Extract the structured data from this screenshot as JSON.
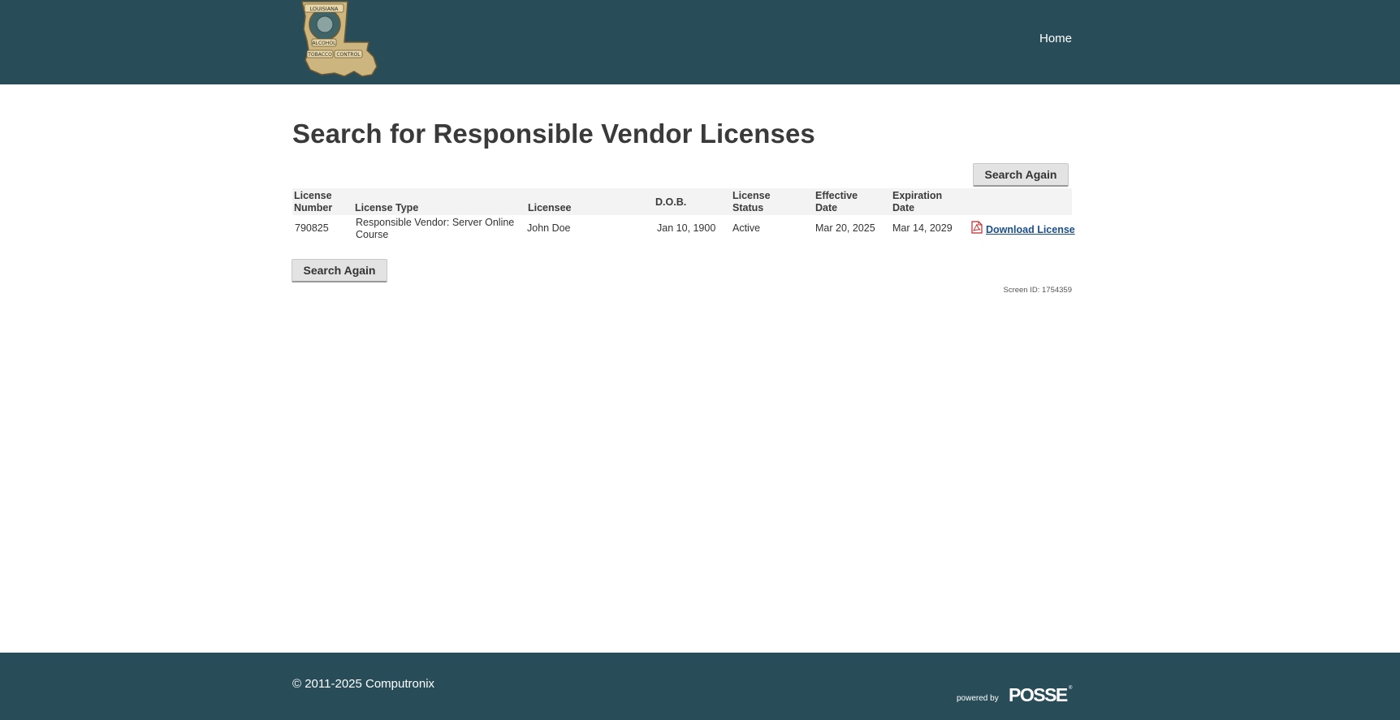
{
  "header": {
    "logo_text": [
      "LOUISIANA",
      "ALCOHOL",
      "TOBACCO",
      "CONTROL"
    ],
    "nav_home": "Home"
  },
  "page": {
    "title": "Search for Responsible Vendor Licenses",
    "search_again_label": "Search Again",
    "screen_id": "Screen ID: 1754359"
  },
  "table": {
    "columns": {
      "license_number_1": "License",
      "license_number_2": "Number",
      "license_type": "License Type",
      "licensee": "Licensee",
      "dob": "D.O.B.",
      "license_status_1": "License",
      "license_status_2": "Status",
      "effective_date_1": "Effective",
      "effective_date_2": "Date",
      "expiration_date_1": "Expiration",
      "expiration_date_2": "Date"
    },
    "rows": [
      {
        "license_number": "790825",
        "license_type_1": "Responsible Vendor: Server Online",
        "license_type_2": "Course",
        "licensee": "John Doe",
        "dob": "Jan 10, 1900",
        "status": "Active",
        "effective_date": "Mar 20, 2025",
        "expiration_date": "Mar 14, 2029",
        "download_label": "Download License"
      }
    ]
  },
  "footer": {
    "copyright": "© 2011-2025 Computronix",
    "powered_by": "powered by",
    "brand": "POSSE",
    "brand_mark": "®"
  },
  "colors": {
    "header_bg": "#284d58",
    "footer_bg": "#284d58",
    "link": "#1a4f8c",
    "button_bg": "#e3e3e3"
  },
  "icons": {
    "logo": "louisiana-atc-badge-icon",
    "download": "pdf-file-icon"
  }
}
